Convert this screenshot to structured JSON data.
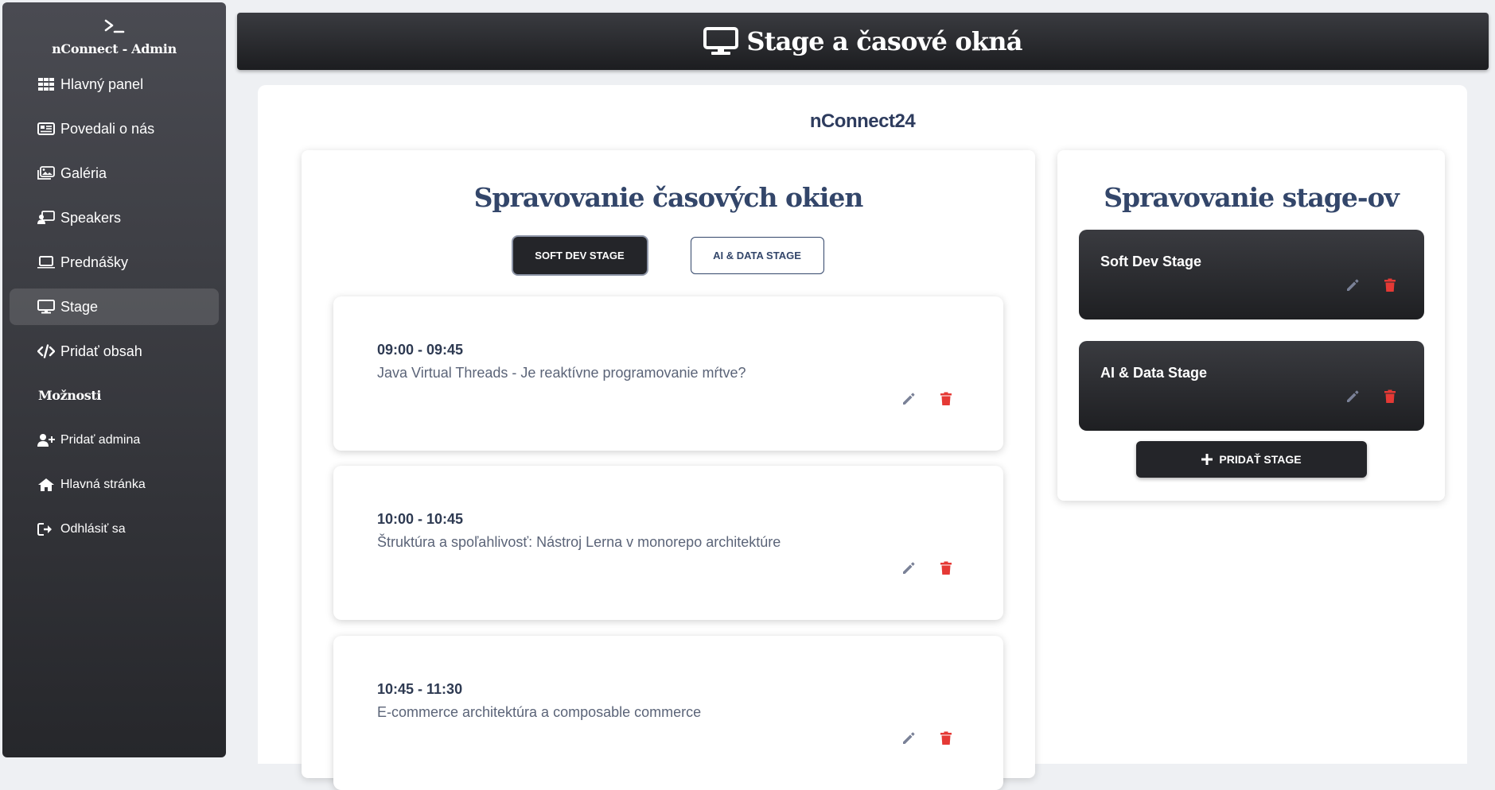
{
  "sidebar": {
    "brand_title": "nConnect - Admin",
    "items": [
      {
        "label": "Hlavný panel",
        "icon": "grid-icon"
      },
      {
        "label": "Povedali o nás",
        "icon": "newspaper-icon"
      },
      {
        "label": "Galéria",
        "icon": "images-icon"
      },
      {
        "label": "Speakers",
        "icon": "chalkboard-user-icon"
      },
      {
        "label": "Prednášky",
        "icon": "laptop-icon"
      },
      {
        "label": "Stage",
        "icon": "desktop-icon"
      },
      {
        "label": "Pridať obsah",
        "icon": "code-icon"
      }
    ],
    "active_item": "Stage",
    "options_label": "Možnosti",
    "options": [
      {
        "label": "Pridať admina",
        "icon": "user-plus-icon"
      },
      {
        "label": "Hlavná stránka",
        "icon": "home-icon"
      },
      {
        "label": "Odhlásiť sa",
        "icon": "sign-out-icon"
      }
    ]
  },
  "header": {
    "title": "Stage a časové okná",
    "icon": "desktop-icon"
  },
  "main": {
    "event_name": "nConnect24",
    "slots_section": {
      "heading": "Spravovanie časových okien",
      "tabs": [
        {
          "label": "SOFT DEV STAGE",
          "active": true
        },
        {
          "label": "AI & DATA STAGE",
          "active": false
        }
      ],
      "slots": [
        {
          "time": "09:00 - 09:45",
          "talk": "Java Virtual Threads - Je reaktívne programovanie mŕtve?"
        },
        {
          "time": "10:00 - 10:45",
          "talk": "Štruktúra a spoľahlivosť: Nástroj Lerna v monorepo architektúre"
        },
        {
          "time": "10:45 - 11:30",
          "talk": "E-commerce architektúra a composable commerce"
        }
      ]
    },
    "stages_section": {
      "heading": "Spravovanie stage-ov",
      "stages": [
        {
          "name": "Soft Dev Stage"
        },
        {
          "name": "AI & Data Stage"
        }
      ],
      "add_button_label": "PRIDAŤ STAGE"
    }
  },
  "colors": {
    "accent_dark": "#242529",
    "heading_blue": "#33466a",
    "edit_icon": "#7a8197",
    "delete_icon": "#e53935"
  }
}
